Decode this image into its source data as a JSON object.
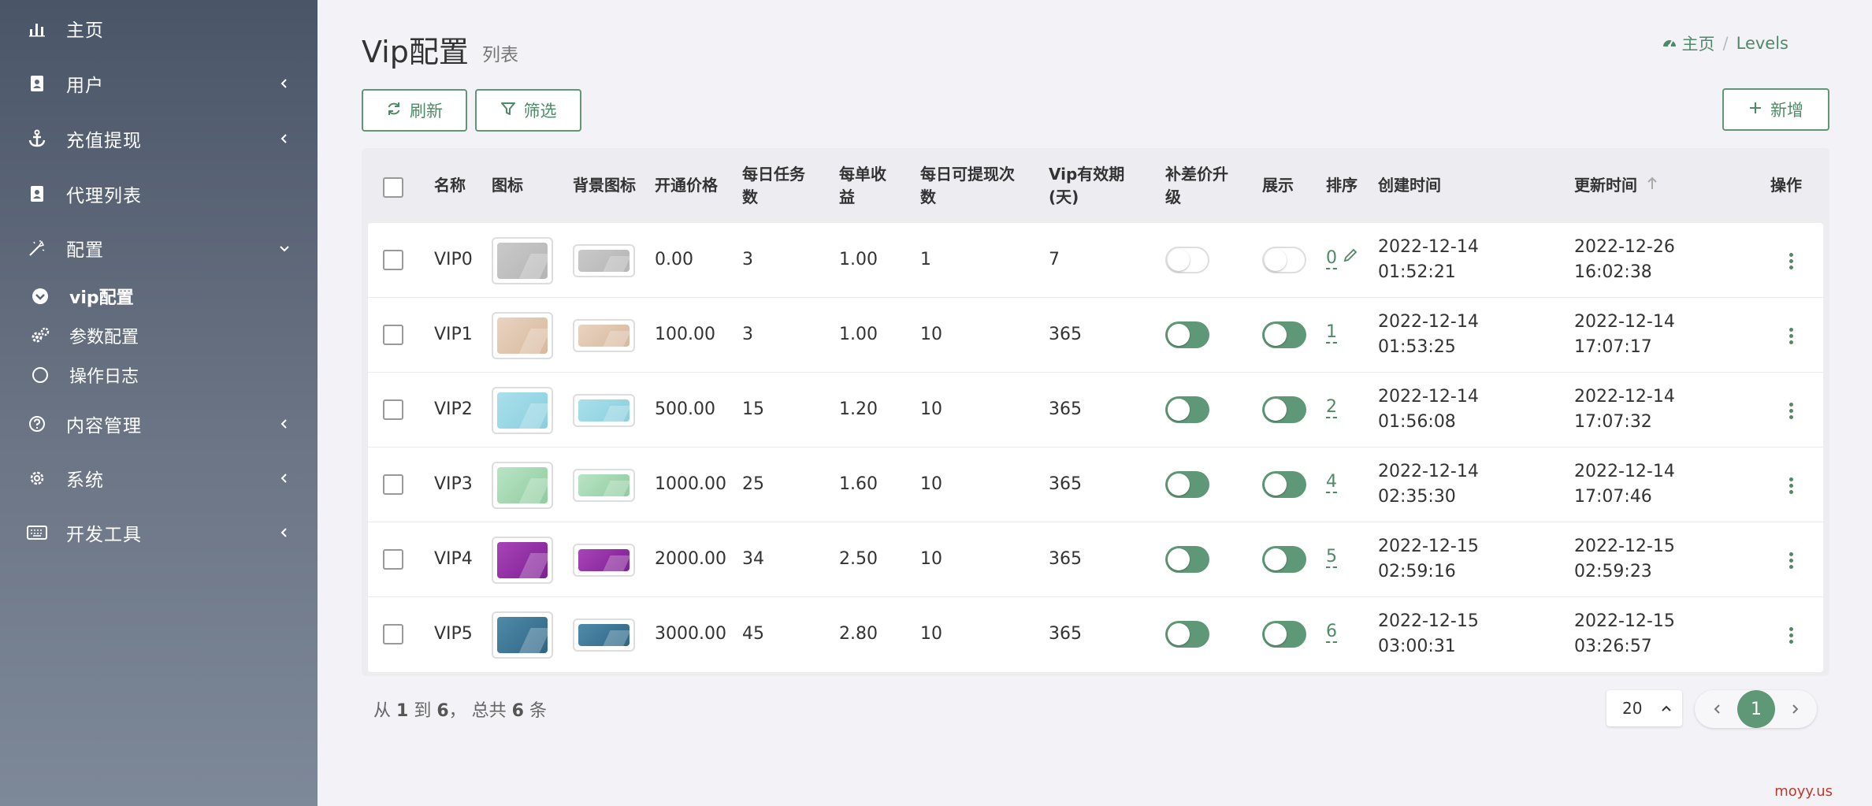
{
  "sidebar": {
    "items": [
      {
        "label": "主页",
        "icon": "bar-chart-icon"
      },
      {
        "label": "用户",
        "icon": "user-card-icon"
      },
      {
        "label": "充值提现",
        "icon": "anchor-icon"
      },
      {
        "label": "代理列表",
        "icon": "user-card-icon"
      },
      {
        "label": "配置",
        "icon": "magic-icon"
      },
      {
        "label": "内容管理",
        "icon": "question-icon"
      },
      {
        "label": "系统",
        "icon": "gear-icon"
      },
      {
        "label": "开发工具",
        "icon": "keyboard-icon"
      }
    ],
    "sub_items": [
      {
        "label": "vip配置",
        "icon": "chevron-circle-icon"
      },
      {
        "label": "参数配置",
        "icon": "cogs-icon"
      },
      {
        "label": "操作日志",
        "icon": "circle-icon"
      }
    ]
  },
  "header": {
    "title": "Vip配置",
    "subtitle": "列表",
    "breadcrumb_home": "主页",
    "breadcrumb_sep": "/",
    "breadcrumb_current": "Levels"
  },
  "toolbar": {
    "refresh_label": "刷新",
    "filter_label": "筛选",
    "add_label": "新增"
  },
  "table": {
    "columns": {
      "name": "名称",
      "icon": "图标",
      "bg_icon": "背景图标",
      "price": "开通价格",
      "daily_tasks_1": "每日任务",
      "daily_tasks_2": "数",
      "per_income_1": "每单收",
      "per_income_2": "益",
      "daily_withdraw_1": "每日可提现次",
      "daily_withdraw_2": "数",
      "valid_1": "Vip有效期",
      "valid_2": "(天)",
      "upgrade_1": "补差价升",
      "upgrade_2": "级",
      "show": "展示",
      "order": "排序",
      "created": "创建时间",
      "updated": "更新时间",
      "actions": "操作"
    },
    "rows": [
      {
        "name": "VIP0",
        "price": "0.00",
        "tasks": "3",
        "income": "1.00",
        "withdraw": "1",
        "valid": "7",
        "upgrade": false,
        "show": false,
        "order": "0",
        "created_date": "2022-12-14",
        "created_time": "01:52:21",
        "updated_date": "2022-12-26",
        "updated_time": "16:02:38",
        "color1": "#c9c9c9",
        "color2": "#b5b5b5"
      },
      {
        "name": "VIP1",
        "price": "100.00",
        "tasks": "3",
        "income": "1.00",
        "withdraw": "10",
        "valid": "365",
        "upgrade": true,
        "show": true,
        "order": "1",
        "created_date": "2022-12-14",
        "created_time": "01:53:25",
        "updated_date": "2022-12-14",
        "updated_time": "17:07:17",
        "color1": "#e8d3c1",
        "color2": "#d8b89c"
      },
      {
        "name": "VIP2",
        "price": "500.00",
        "tasks": "15",
        "income": "1.20",
        "withdraw": "10",
        "valid": "365",
        "upgrade": true,
        "show": true,
        "order": "2",
        "created_date": "2022-12-14",
        "created_time": "01:56:08",
        "updated_date": "2022-12-14",
        "updated_time": "17:07:32",
        "color1": "#a9dfea",
        "color2": "#8acfdf"
      },
      {
        "name": "VIP3",
        "price": "1000.00",
        "tasks": "25",
        "income": "1.60",
        "withdraw": "10",
        "valid": "365",
        "upgrade": true,
        "show": true,
        "order": "4",
        "created_date": "2022-12-14",
        "created_time": "02:35:30",
        "updated_date": "2022-12-14",
        "updated_time": "17:07:46",
        "color1": "#b9e4c5",
        "color2": "#8fcc9e"
      },
      {
        "name": "VIP4",
        "price": "2000.00",
        "tasks": "34",
        "income": "2.50",
        "withdraw": "10",
        "valid": "365",
        "upgrade": true,
        "show": true,
        "order": "5",
        "created_date": "2022-12-15",
        "created_time": "02:59:16",
        "updated_date": "2022-12-15",
        "updated_time": "02:59:23",
        "color1": "#a744b8",
        "color2": "#7e1f93"
      },
      {
        "name": "VIP5",
        "price": "3000.00",
        "tasks": "45",
        "income": "2.80",
        "withdraw": "10",
        "valid": "365",
        "upgrade": true,
        "show": true,
        "order": "6",
        "created_date": "2022-12-15",
        "created_time": "03:00:31",
        "updated_date": "2022-12-15",
        "updated_time": "03:26:57",
        "color1": "#4f8aa8",
        "color2": "#2f6685"
      }
    ]
  },
  "footer": {
    "s1": "从",
    "from": "1",
    "s2": "到",
    "to": "6",
    "s3": "， 总共",
    "total": "6",
    "s4": "条",
    "page_size": "20",
    "current_page": "1"
  },
  "watermark": "moyy.us",
  "colors": {
    "accent": "#5e9877",
    "sidebar_top": "#4a5568",
    "sidebar_bottom": "#7d8899"
  }
}
